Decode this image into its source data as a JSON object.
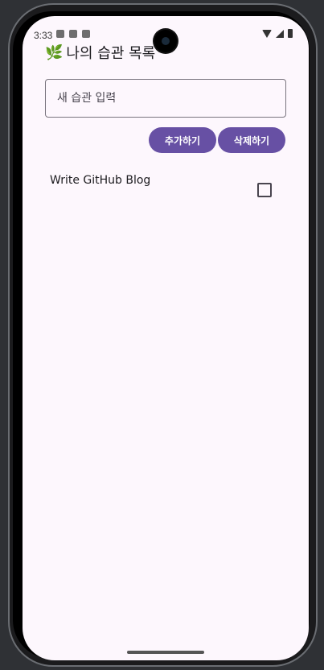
{
  "status_bar": {
    "time": "3:33"
  },
  "app": {
    "title_icon": "🌿",
    "title": "나의 습관 목록"
  },
  "input": {
    "placeholder": "새 습관 입력",
    "value": ""
  },
  "buttons": {
    "add_label": "추가하기",
    "delete_label": "삭제하기"
  },
  "habits": [
    {
      "name": "Write GitHub Blog",
      "checked": false
    }
  ],
  "colors": {
    "accent": "#6750a4",
    "background": "#fdf7fd"
  }
}
